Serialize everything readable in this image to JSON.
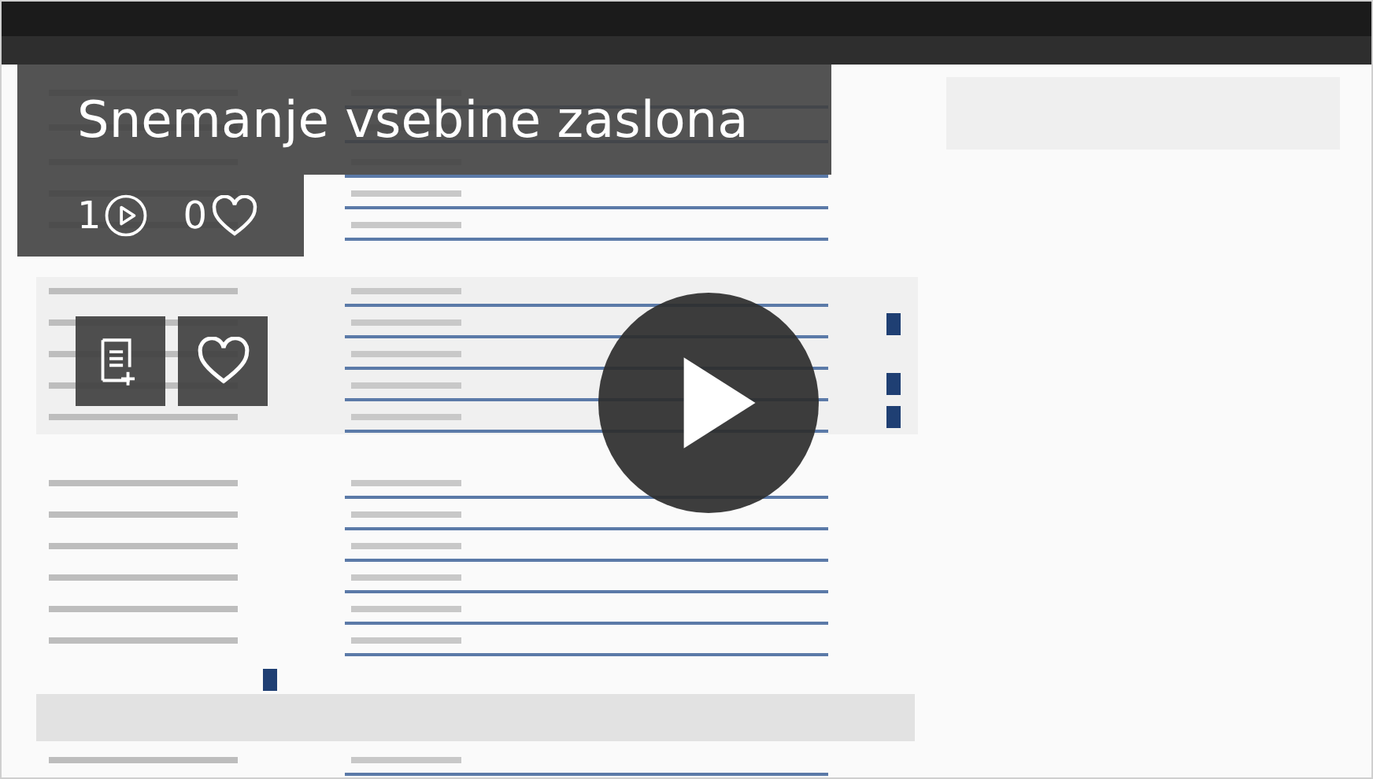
{
  "video": {
    "title": "Snemanje vsebine zaslona",
    "plays": "1",
    "likes": "0"
  }
}
